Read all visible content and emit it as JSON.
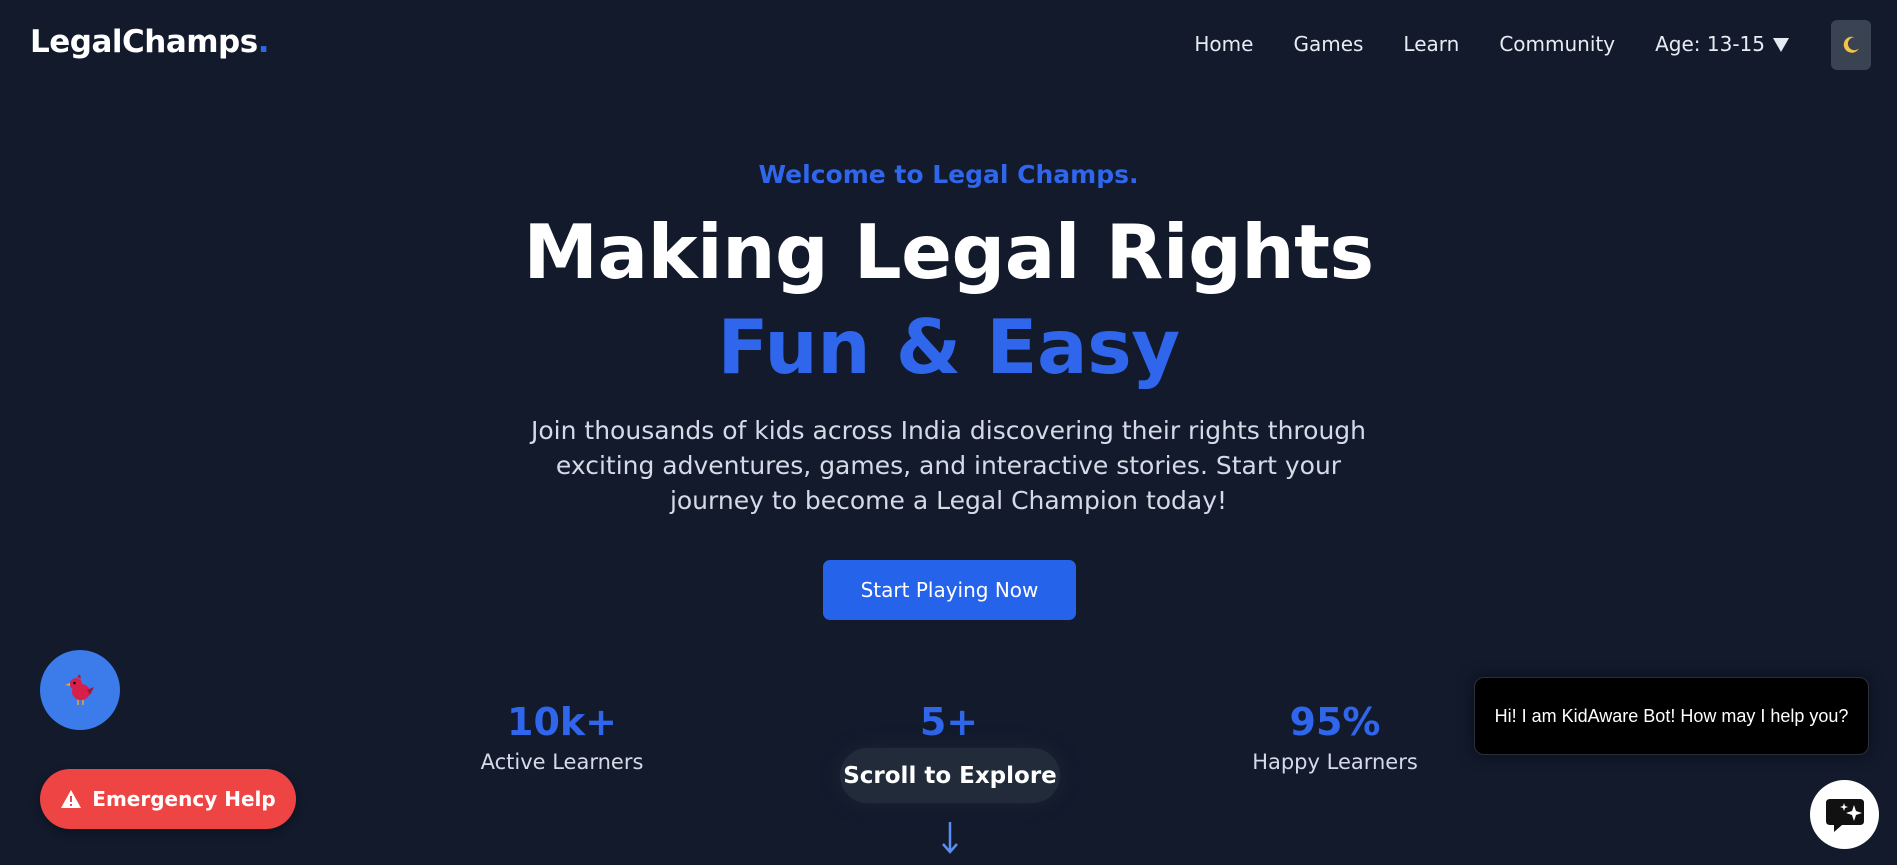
{
  "nav": {
    "logo_text": "LegalChamps",
    "logo_dot": ".",
    "links": [
      "Home",
      "Games",
      "Learn",
      "Community"
    ],
    "age_label": "Age: 13-15",
    "theme_icon": "moon-icon"
  },
  "hero": {
    "welcome": "Welcome to Legal Champs.",
    "headline_line1": "Making Legal Rights",
    "headline_line2": "Fun & Easy",
    "description": "Join thousands of kids across India discovering their rights through exciting adventures, games, and interactive stories. Start your journey to become a Legal Champion today!",
    "cta_label": "Start Playing Now"
  },
  "stats": [
    {
      "value": "10k+",
      "label": "Active Learners"
    },
    {
      "value": "5+",
      "label": ""
    },
    {
      "value": "95%",
      "label": "Happy Learners"
    }
  ],
  "scroll": {
    "label": "Scroll to Explore",
    "arrow_icon": "arrow-down-icon"
  },
  "floating": {
    "mascot_icon": "bird-mascot-icon",
    "emergency_label": "Emergency Help",
    "emergency_icon": "warning-icon"
  },
  "chat": {
    "bubble_text": "Hi! I am KidAware Bot! How may I help you?",
    "icon": "chat-sparkle-icon"
  },
  "colors": {
    "background": "#121a2c",
    "accent": "#2f66eb",
    "emergency": "#ef4444",
    "mascot_bg": "#3b7bea"
  }
}
